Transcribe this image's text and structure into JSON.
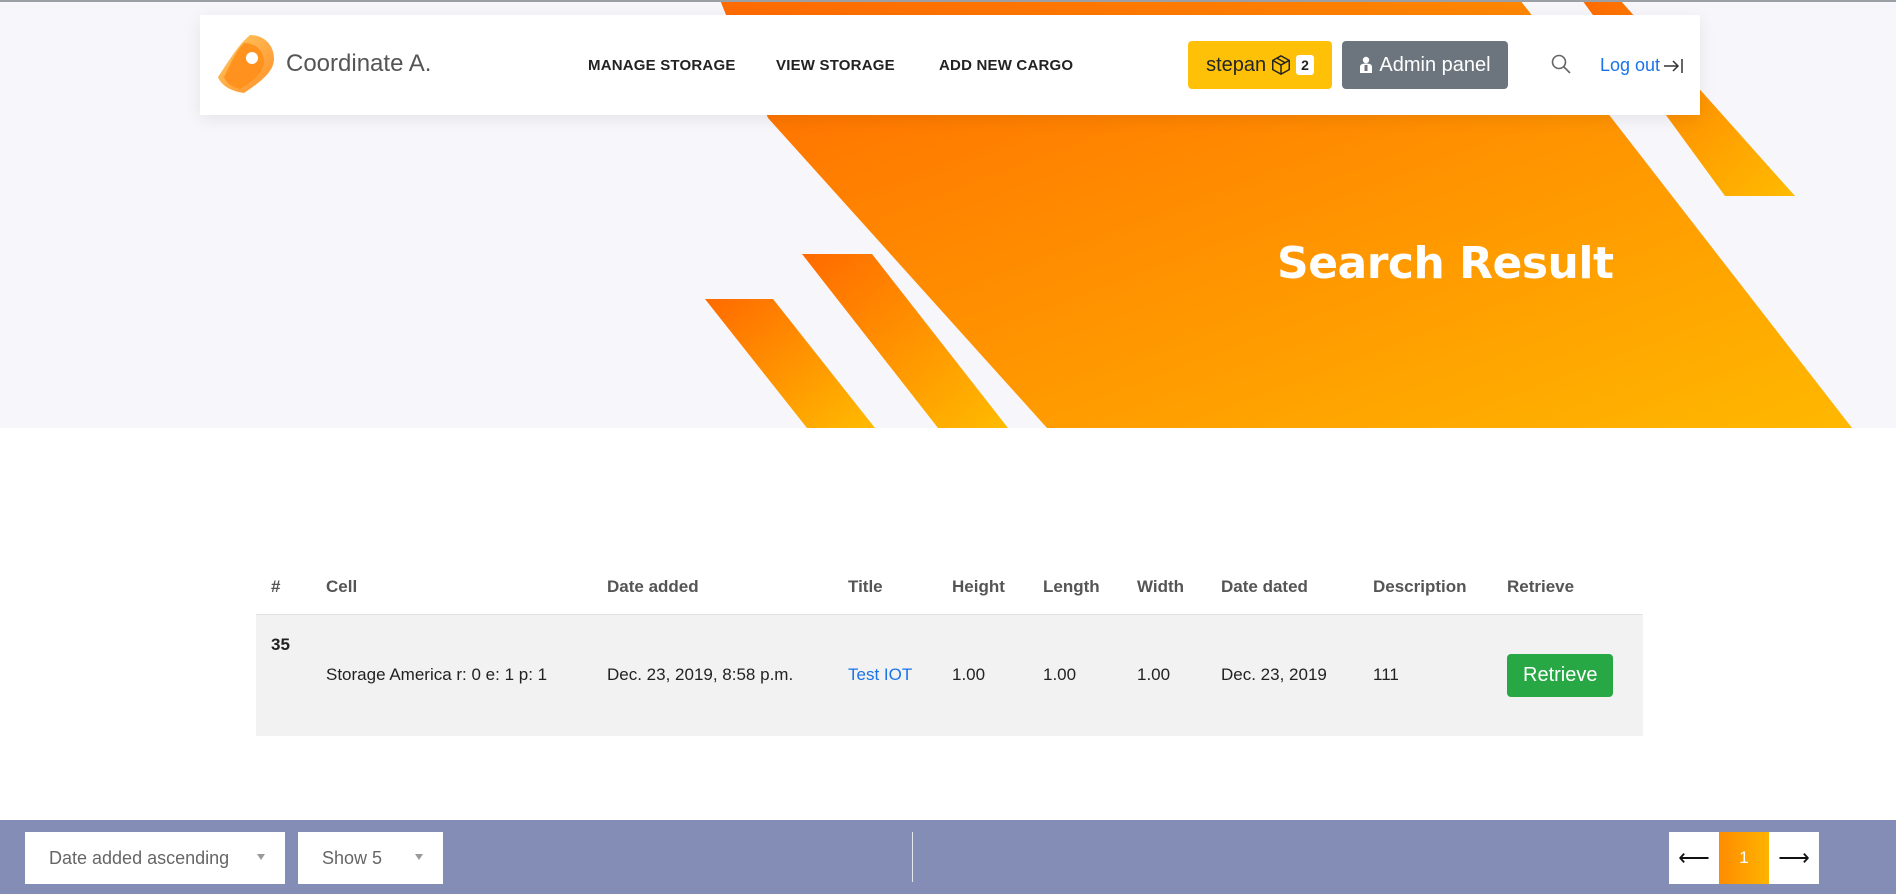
{
  "brand": {
    "name": "Coordinate A."
  },
  "nav": {
    "links": [
      "MANAGE STORAGE",
      "VIEW STORAGE",
      "ADD NEW CARGO"
    ],
    "user_label": "stepan",
    "cart_count": "2",
    "admin_label": "Admin panel",
    "logout_label": "Log out"
  },
  "hero": {
    "title": "Search Result"
  },
  "table": {
    "headers": [
      "#",
      "Cell",
      "Date added",
      "Title",
      "Height",
      "Length",
      "Width",
      "Date dated",
      "Description",
      "Retrieve"
    ],
    "rows": [
      {
        "id": "35",
        "cell": "Storage America r: 0 e: 1 p: 1",
        "date_added": "Dec. 23, 2019, 8:58 p.m.",
        "title": "Test IOT",
        "height": "1.00",
        "length": "1.00",
        "width": "1.00",
        "date_dated": "Dec. 23, 2019",
        "description": "111",
        "action": "Retrieve"
      }
    ]
  },
  "footer": {
    "sort_value": "Date added ascending",
    "show_value": "Show 5",
    "page_current": "1",
    "prev_symbol": "⟵",
    "next_symbol": "⟶"
  },
  "colors": {
    "accent_orange": "#ff6a00",
    "accent_yellow": "#ffb300",
    "footer_bg": "#848db6",
    "retrieve_green": "#28a745",
    "admin_gray": "#6c757d",
    "user_yellow": "#ffc107"
  },
  "icons": [
    "location-pin-icon",
    "package-box-icon",
    "admin-user-icon",
    "search-icon",
    "logout-arrow-icon",
    "caret-down-icon"
  ]
}
